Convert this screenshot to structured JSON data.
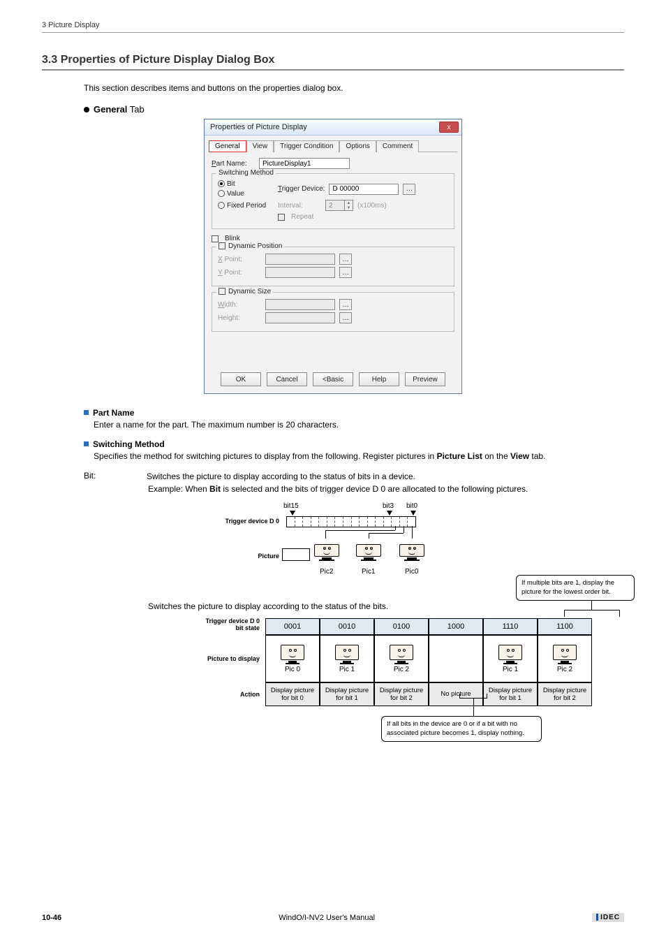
{
  "running_header": "3 Picture Display",
  "section_number_title": "3.3   Properties of Picture Display Dialog Box",
  "intro": "This section describes items and buttons on the properties dialog box.",
  "general_tab_heading_bold": "General",
  "general_tab_heading_rest": " Tab",
  "dialog": {
    "title": "Properties of Picture Display",
    "close": "x",
    "tabs": [
      "General",
      "View",
      "Trigger Condition",
      "Options",
      "Comment"
    ],
    "part_name_label_pre": "P",
    "part_name_label_rest": "art Name:",
    "part_name_value": "PictureDisplay1",
    "switching_method_title": "Switching Method",
    "radio_bit_pre": "B",
    "radio_bit_rest": "it",
    "radio_value_pre": "V",
    "radio_value_rest": "alue",
    "radio_fixed_pre": "F",
    "radio_fixed_rest": "ixed Period",
    "trigger_device_pre": "T",
    "trigger_device_rest": "rigger Device:",
    "trigger_device_value": "D 00000",
    "interval_label": "Interval:",
    "interval_value": "2",
    "interval_suffix": "(x100ms)",
    "repeat_pre": "R",
    "repeat_rest": "epeat",
    "blink_pre": "k",
    "blink_label": "Blin",
    "dyn_pos_title_pre": "s",
    "dyn_pos_title": "Dynamic Po",
    "dyn_pos_title_post": "ition",
    "xpoint_pre": "X",
    "xpoint_rest": " Point:",
    "ypoint_pre": "Y",
    "ypoint_rest": " Point:",
    "dyn_size_title_pre": "z",
    "dyn_size_title": "Dynamic Si",
    "dyn_size_title_post": "e",
    "width_pre": "W",
    "width_rest": "idth:",
    "height_label": "Height:",
    "buttons": {
      "ok": "OK",
      "cancel": "Cancel",
      "basic_pre": "<",
      "basic": " Basic",
      "help": "Help",
      "preview_pre": "P",
      "preview_rest": "review"
    }
  },
  "desc": {
    "part_name_title": "Part Name",
    "part_name_text": "Enter a name for the part. The maximum number is 20 characters.",
    "switching_title": "Switching Method",
    "switching_text_1": "Specifies the method for switching pictures to display from the following. Register pictures in ",
    "switching_bold_1": "Picture List",
    "switching_text_2": " on the ",
    "switching_bold_2": "View",
    "switching_text_3": " tab."
  },
  "bit_def": {
    "term": "Bit:",
    "line1": "Switches the picture to display according to the status of bits in a device.",
    "example_pre": "Example: When ",
    "example_bold": "Bit",
    "example_post": " is selected and the bits of trigger device D 0 are allocated to the following pictures."
  },
  "diagram1": {
    "bit15": "bit15",
    "bit3": "bit3",
    "bit0": "bit0",
    "trigger_label": "Trigger device D 0",
    "picture_label": "Picture",
    "pic0": "Pic0",
    "pic1": "Pic1",
    "pic2": "Pic2"
  },
  "switch_text2": "Switches the picture to display according to the status of the bits.",
  "callout_top": "If multiple bits are 1, display the picture for the lowest order bit.",
  "state_table": {
    "row1_label_l1": "Trigger device D 0",
    "row1_label_l2": "bit state",
    "row2_label": "Picture to display",
    "row3_label": "Action",
    "states": [
      "0001",
      "0010",
      "0100",
      "1000",
      "1110",
      "1100"
    ],
    "pics": [
      "Pic 0",
      "Pic 1",
      "Pic 2",
      "",
      "Pic 1",
      "Pic 2"
    ],
    "actions": [
      "Display picture for bit 0",
      "Display picture for bit 1",
      "Display picture for bit 2",
      "No picture",
      "Display picture for bit 1",
      "Display picture for bit 2"
    ]
  },
  "callout_bottom": "If all bits in the device are 0 or if a bit with no associated picture becomes 1, display nothing.",
  "footer": {
    "page": "10-46",
    "manual": "WindO/I-NV2 User's Manual",
    "brand": "IDEC"
  }
}
